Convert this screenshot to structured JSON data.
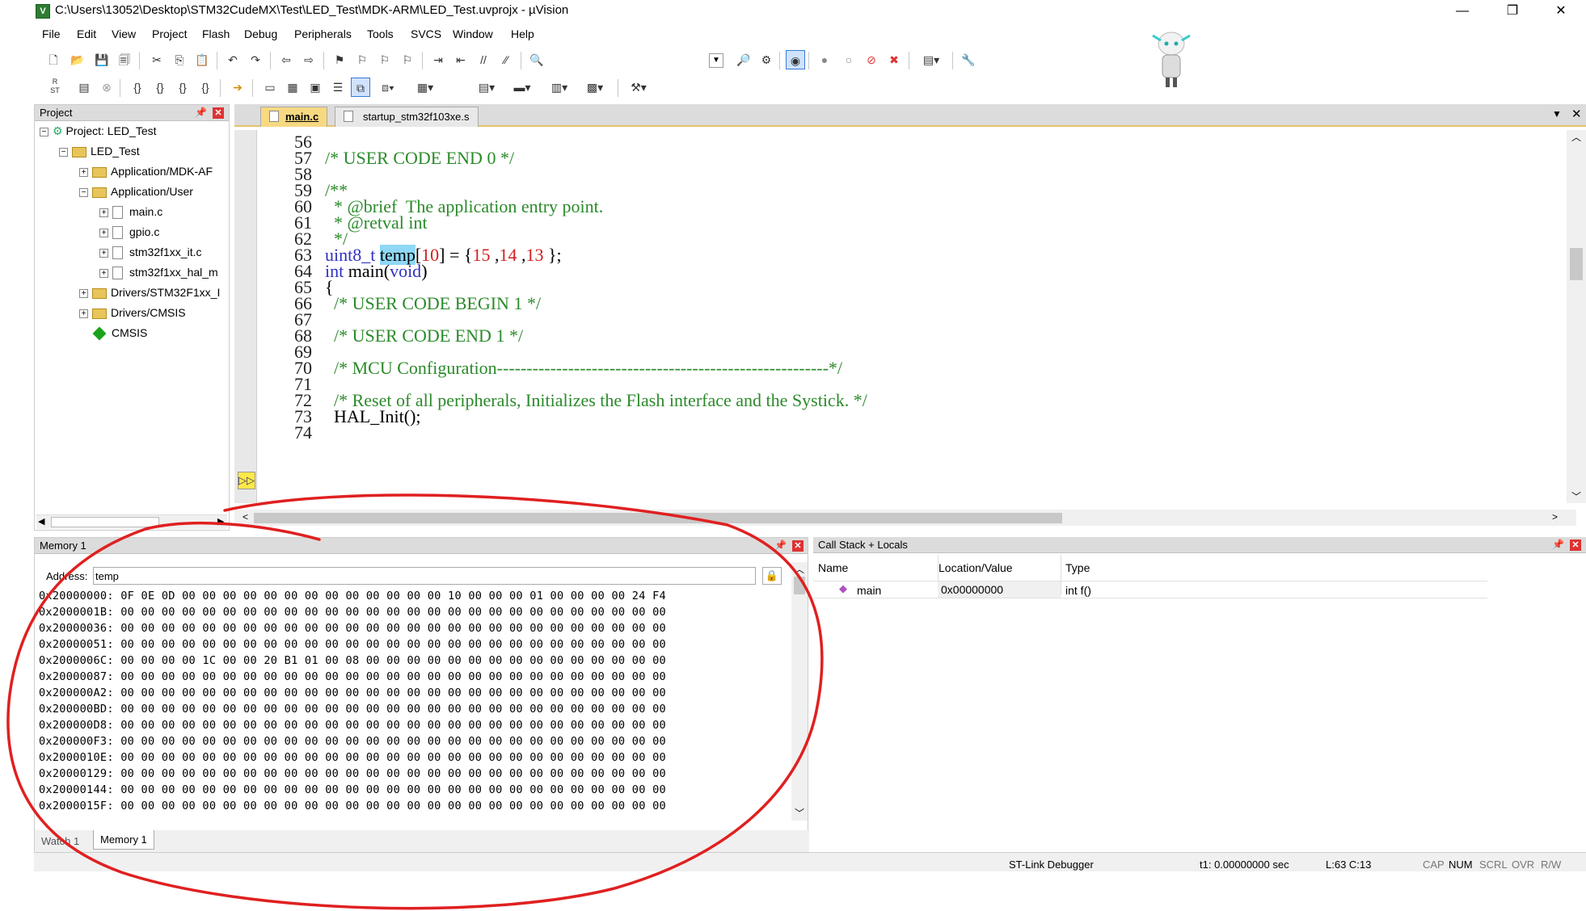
{
  "window": {
    "title": "C:\\Users\\13052\\Desktop\\STM32CudeMX\\Test\\LED_Test\\MDK-ARM\\LED_Test.uvprojx - µVision",
    "app_icon": "V"
  },
  "menu": [
    "File",
    "Edit",
    "View",
    "Project",
    "Flash",
    "Debug",
    "Peripherals",
    "Tools",
    "SVCS",
    "Window",
    "Help"
  ],
  "project_pane": {
    "title": "Project",
    "items": [
      {
        "label": "Project: LED_Test",
        "level": 0,
        "kind": "project"
      },
      {
        "label": "LED_Test",
        "level": 1,
        "kind": "folder"
      },
      {
        "label": "Application/MDK-AF",
        "level": 2,
        "kind": "folder"
      },
      {
        "label": "Application/User",
        "level": 2,
        "kind": "folder"
      },
      {
        "label": "main.c",
        "level": 3,
        "kind": "file"
      },
      {
        "label": "gpio.c",
        "level": 3,
        "kind": "file"
      },
      {
        "label": "stm32f1xx_it.c",
        "level": 3,
        "kind": "file"
      },
      {
        "label": "stm32f1xx_hal_m",
        "level": 3,
        "kind": "file"
      },
      {
        "label": "Drivers/STM32F1xx_I",
        "level": 2,
        "kind": "folder"
      },
      {
        "label": "Drivers/CMSIS",
        "level": 2,
        "kind": "folder"
      },
      {
        "label": "CMSIS",
        "level": 2,
        "kind": "diamond"
      }
    ]
  },
  "editor": {
    "tabs": [
      {
        "label": "main.c",
        "active": true
      },
      {
        "label": "startup_stm32f103xe.s",
        "active": false
      }
    ],
    "lines": [
      {
        "n": "56",
        "text": ""
      },
      {
        "n": "57",
        "text": "/* USER CODE END 0 */"
      },
      {
        "n": "58",
        "text": ""
      },
      {
        "n": "59",
        "text": "/**"
      },
      {
        "n": "60",
        "text": "  * @brief  The application entry point."
      },
      {
        "n": "61",
        "text": "  * @retval int"
      },
      {
        "n": "62",
        "text": "  */"
      },
      {
        "n": "63",
        "text": "uint8_t temp[10] = {15 ,14 ,13 };"
      },
      {
        "n": "64",
        "text": "int main(void)"
      },
      {
        "n": "65",
        "text": "{"
      },
      {
        "n": "66",
        "text": "  /* USER CODE BEGIN 1 */"
      },
      {
        "n": "67",
        "text": ""
      },
      {
        "n": "68",
        "text": "  /* USER CODE END 1 */"
      },
      {
        "n": "69",
        "text": ""
      },
      {
        "n": "70",
        "text": "  /* MCU Configuration--------------------------------------------------------*/"
      },
      {
        "n": "71",
        "text": ""
      },
      {
        "n": "72",
        "text": "  /* Reset of all peripherals, Initializes the Flash interface and the Systick. */"
      },
      {
        "n": "73",
        "text": "  HAL_Init();"
      },
      {
        "n": "74",
        "text": ""
      }
    ]
  },
  "memory": {
    "title": "Memory 1",
    "address_label": "Address:",
    "address_value": "temp",
    "rows": [
      "0x20000000: 0F 0E 0D 00 00 00 00 00 00 00 00 00 00 00 00 00 10 00 00 00 01 00 00 00 00 24 F4",
      "0x2000001B: 00 00 00 00 00 00 00 00 00 00 00 00 00 00 00 00 00 00 00 00 00 00 00 00 00 00 00",
      "0x20000036: 00 00 00 00 00 00 00 00 00 00 00 00 00 00 00 00 00 00 00 00 00 00 00 00 00 00 00",
      "0x20000051: 00 00 00 00 00 00 00 00 00 00 00 00 00 00 00 00 00 00 00 00 00 00 00 00 00 00 00",
      "0x2000006C: 00 00 00 00 1C 00 00 20 B1 01 00 08 00 00 00 00 00 00 00 00 00 00 00 00 00 00 00",
      "0x20000087: 00 00 00 00 00 00 00 00 00 00 00 00 00 00 00 00 00 00 00 00 00 00 00 00 00 00 00",
      "0x200000A2: 00 00 00 00 00 00 00 00 00 00 00 00 00 00 00 00 00 00 00 00 00 00 00 00 00 00 00",
      "0x200000BD: 00 00 00 00 00 00 00 00 00 00 00 00 00 00 00 00 00 00 00 00 00 00 00 00 00 00 00",
      "0x200000D8: 00 00 00 00 00 00 00 00 00 00 00 00 00 00 00 00 00 00 00 00 00 00 00 00 00 00 00",
      "0x200000F3: 00 00 00 00 00 00 00 00 00 00 00 00 00 00 00 00 00 00 00 00 00 00 00 00 00 00 00",
      "0x2000010E: 00 00 00 00 00 00 00 00 00 00 00 00 00 00 00 00 00 00 00 00 00 00 00 00 00 00 00",
      "0x20000129: 00 00 00 00 00 00 00 00 00 00 00 00 00 00 00 00 00 00 00 00 00 00 00 00 00 00 00",
      "0x20000144: 00 00 00 00 00 00 00 00 00 00 00 00 00 00 00 00 00 00 00 00 00 00 00 00 00 00 00",
      "0x2000015F: 00 00 00 00 00 00 00 00 00 00 00 00 00 00 00 00 00 00 00 00 00 00 00 00 00 00 00"
    ],
    "bottom_tabs": [
      "Watch 1",
      "Memory 1"
    ]
  },
  "callstack": {
    "title": "Call Stack + Locals",
    "columns": [
      "Name",
      "Location/Value",
      "Type"
    ],
    "rows": [
      {
        "name": "main",
        "location": "0x00000000",
        "type": "int f()"
      }
    ]
  },
  "status": {
    "debugger": "ST-Link Debugger",
    "time": "t1: 0.00000000 sec",
    "position": "L:63 C:13",
    "caps": "CAP",
    "num": "NUM",
    "scrl": "SCRL",
    "ovr": "OVR",
    "rw": "R/W"
  },
  "colors": {
    "annotation_red": "#e02020",
    "comment": "#2a8a2a",
    "keyword": "#3030c0",
    "number": "#d02020"
  }
}
